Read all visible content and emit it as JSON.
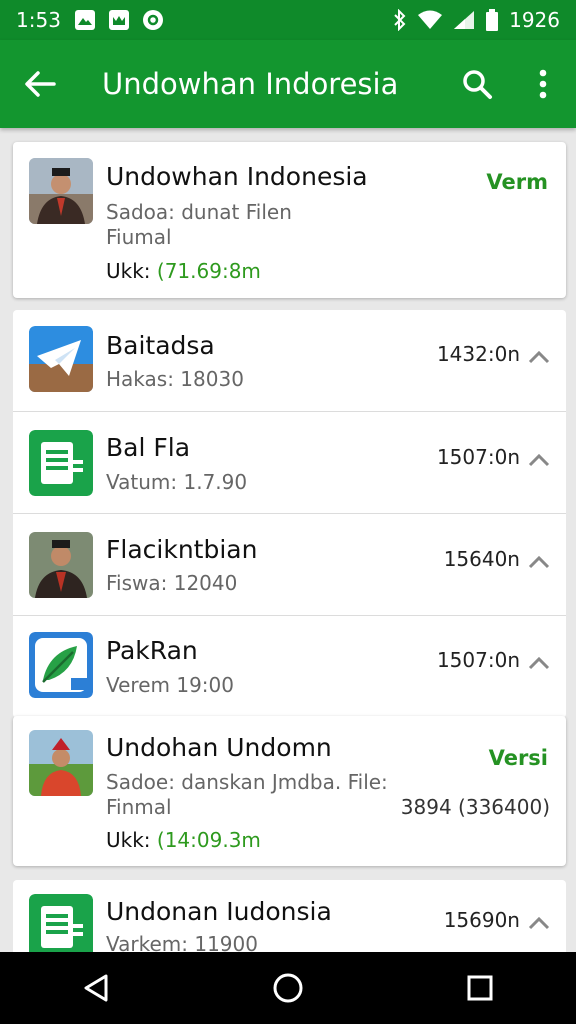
{
  "status_bar": {
    "time": "1:53",
    "battery_label": "1926"
  },
  "app_bar": {
    "title": "Undowhan Indoresia"
  },
  "items": [
    {
      "title": "Undowhan Indonesia",
      "subtitle_line1": "Sadoa: dunat Filen",
      "subtitle_line2": "Fiumal",
      "meta_prefix": "Ukk: ",
      "meta_value": "(71.69:8m",
      "action": "Verm"
    },
    {
      "title": "Baitadsa",
      "subtitle": "Hakas: 18030",
      "time": "1432:0n"
    },
    {
      "title": "Bal Fla",
      "subtitle": "Vatum: 1.7.90",
      "time": "1507:0n"
    },
    {
      "title": "Flacikntbian",
      "subtitle": "Fiswa: 12040",
      "time": "15640n"
    },
    {
      "title": "PakRan",
      "subtitle": "Verem 19:00",
      "time": "1507:0n"
    },
    {
      "title": "Undohan Undomn",
      "subtitle_line1": "Sadoe: danskan Jmdba. File:",
      "subtitle_line2": "Finmal",
      "extra": "3894 (336400)",
      "meta_prefix": "Ukk: ",
      "meta_value": "(14:09.3m",
      "action": "Versi"
    },
    {
      "title": "Undonan Iudonsia",
      "subtitle": "Varkem: 11900",
      "time": "15690n"
    }
  ],
  "colors": {
    "status_bar": "#0f8a2a",
    "app_bar": "#13962f",
    "accent_green": "#259223"
  },
  "icons": [
    "back-arrow-icon",
    "search-icon",
    "overflow-menu-icon",
    "chevron-up-icon",
    "nav-back-icon",
    "nav-home-icon",
    "nav-recents-icon"
  ]
}
